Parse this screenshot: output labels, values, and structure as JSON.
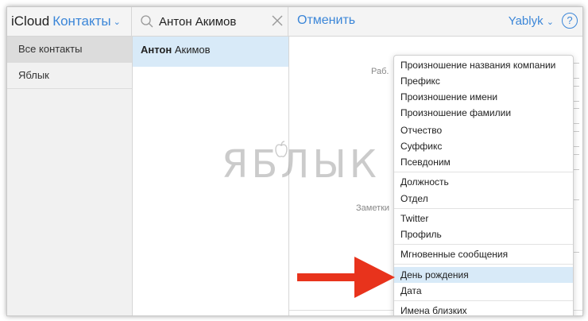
{
  "header": {
    "brand": "iCloud",
    "app_menu": "Контакты",
    "search_value": "Антон Акимов",
    "cancel_label": "Отменить",
    "user_name": "Yablyk",
    "help_label": "?"
  },
  "sidebar": {
    "items": [
      {
        "label": "Все контакты",
        "selected": true
      },
      {
        "label": "Яблык",
        "selected": false
      }
    ]
  },
  "contacts": {
    "items": [
      {
        "first": "Антон",
        "last": "Акимов"
      }
    ]
  },
  "detail": {
    "work_label": "Раб.",
    "notes_label": "Заметки"
  },
  "watermark": {
    "text": "ЯБЛЫК"
  },
  "menu": {
    "items": [
      "Произношение названия компании",
      "Префикс",
      "Произношение имени",
      "Произношение фамилии",
      "Отчество",
      "Суффикс",
      "Псевдоним",
      "Должность",
      "Отдел",
      "Twitter",
      "Профиль",
      "Мгновенные сообщения",
      "День рождения",
      "Дата",
      "Имена близких"
    ],
    "highlighted": "День рождения"
  },
  "colors": {
    "accent": "#3b86d8",
    "selection": "#d8eaf8",
    "arrow": "#e8331c"
  }
}
